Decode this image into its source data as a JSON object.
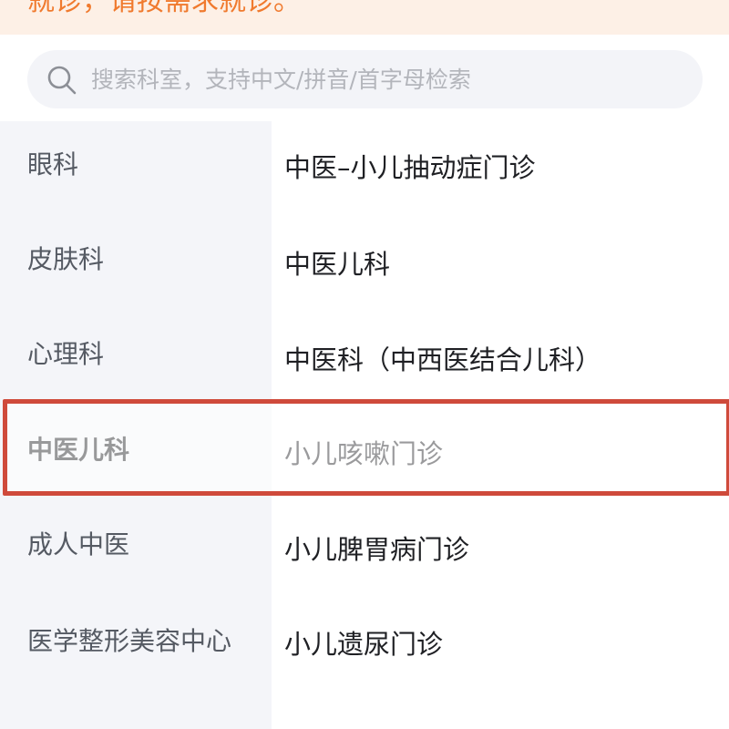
{
  "notice": {
    "text": "就诊，请按需求就诊。"
  },
  "search": {
    "placeholder": "搜索科室，支持中文/拼音/首字母检索"
  },
  "sidebar": {
    "items": [
      {
        "label": "眼科"
      },
      {
        "label": "皮肤科"
      },
      {
        "label": "心理科"
      },
      {
        "label": "中医儿科"
      },
      {
        "label": "成人中医"
      },
      {
        "label": "医学整形美容中心"
      }
    ],
    "active_index": 3
  },
  "departments": {
    "items": [
      {
        "label": "中医–小儿抽动症门诊"
      },
      {
        "label": "中医儿科"
      },
      {
        "label": "中医科（中西医结合儿科）"
      },
      {
        "label": "小儿咳嗽门诊"
      },
      {
        "label": "小儿脾胃病门诊"
      },
      {
        "label": "小儿遗尿门诊"
      }
    ]
  },
  "colors": {
    "accent": "#cf4a3b",
    "notice_bg": "#fdf0e6",
    "notice_text": "#f07a2e"
  }
}
